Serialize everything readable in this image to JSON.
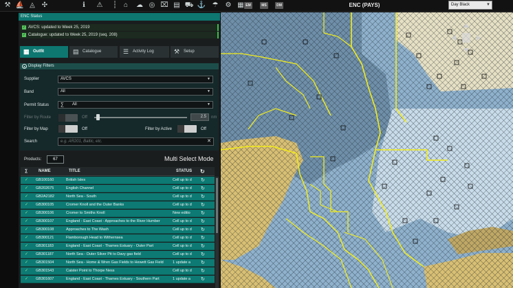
{
  "toolbar": {
    "icons": [
      "chart-tools-icon",
      "sailing-icon",
      "measure-icon",
      "info-icon",
      "warning-icon",
      "home-icon",
      "cloud-download-icon",
      "globe-icon",
      "building-icon",
      "book-icon",
      "cart-icon",
      "anchor-icon",
      "weather-icon",
      "gear-icon"
    ],
    "badges": [
      "EM",
      "MS",
      "DM"
    ],
    "map_title": "ENC (PAYS)",
    "palette_value": "Day Black"
  },
  "enc_status": {
    "title": "ENC Status",
    "items": [
      "AVCS: updated to Week 25, 2019",
      "Catalogue: updated to Week 25, 2019 (seq. 208)"
    ]
  },
  "tabs": [
    {
      "label": "Outfit",
      "icon": "outfit-icon",
      "active": true
    },
    {
      "label": "Catalogue",
      "icon": "catalogue-icon",
      "active": false
    },
    {
      "label": "Activity Log",
      "icon": "activity-log-icon",
      "active": false
    },
    {
      "label": "Setup",
      "icon": "setup-icon",
      "active": false
    }
  ],
  "filters": {
    "title": "Display Filters",
    "supplier_label": "Supplier",
    "supplier_value": "AVCS",
    "band_label": "Band",
    "band_value": "All",
    "permit_label": "Permit Status",
    "permit_value": "All",
    "route_label": "Filter by Route",
    "route_toggle": "Off",
    "route_value": "2.5",
    "route_unit": "nm",
    "map_label": "Filter by Map",
    "map_toggle": "Off",
    "active_label": "Filter by Active",
    "active_toggle": "Off",
    "search_label": "Search",
    "search_placeholder": "e.g. AR201, Baltic, etc."
  },
  "products": {
    "label": "Products:",
    "count": "67",
    "mode": "Multi Select Mode"
  },
  "table": {
    "headers": {
      "sigma": "∑",
      "name": "NAME",
      "title": "TITLE",
      "status": "STATUS"
    },
    "rows": [
      {
        "name": "GB100160",
        "title": "British Isles",
        "status": "Cell up to d"
      },
      {
        "name": "GB202675",
        "title": "English Channel",
        "status": "Cell up to d"
      },
      {
        "name": "GB2A2182",
        "title": "North Sea - South",
        "status": "Cell up to d"
      },
      {
        "name": "GB300105",
        "title": "Cromer Knoll and the Outer Banks",
        "status": "Cell up to d"
      },
      {
        "name": "GB300106",
        "title": "Cromer to Smiths Knoll",
        "status": "New editio"
      },
      {
        "name": "GB300107",
        "title": "England - East Coast - Approaches to the River Humber",
        "status": "Cell up to d"
      },
      {
        "name": "GB300108",
        "title": "Approaches to The Wash",
        "status": "Cell up to d"
      },
      {
        "name": "GB300121",
        "title": "Flamborough Head to Withernsea",
        "status": "Cell up to d"
      },
      {
        "name": "GB301183",
        "title": "England - East Coast - Thames Estuary - Outer Part",
        "status": "Cell up to d"
      },
      {
        "name": "GB301187",
        "title": "North Sea - Outer Silver Pit to Davy gas field",
        "status": "Cell up to d"
      },
      {
        "name": "GB301504",
        "title": "North Sea - Home & Wren Gas Fields to Hewett Gas Field",
        "status": "1 update a"
      },
      {
        "name": "GB301543",
        "title": "Caister Point to Thorpe Ness",
        "status": "Cell up to d"
      },
      {
        "name": "GB301607",
        "title": "England - East Coast - Thames Estuary - Southern Part",
        "status": "1 update a"
      }
    ]
  },
  "colors": {
    "accent": "#0d7770",
    "row": "#0d7a73",
    "status_ok": "#3dbb4a",
    "route_yellow": "#f3ec1a",
    "land": "#d8bf73",
    "water": "#8fb1cc"
  }
}
